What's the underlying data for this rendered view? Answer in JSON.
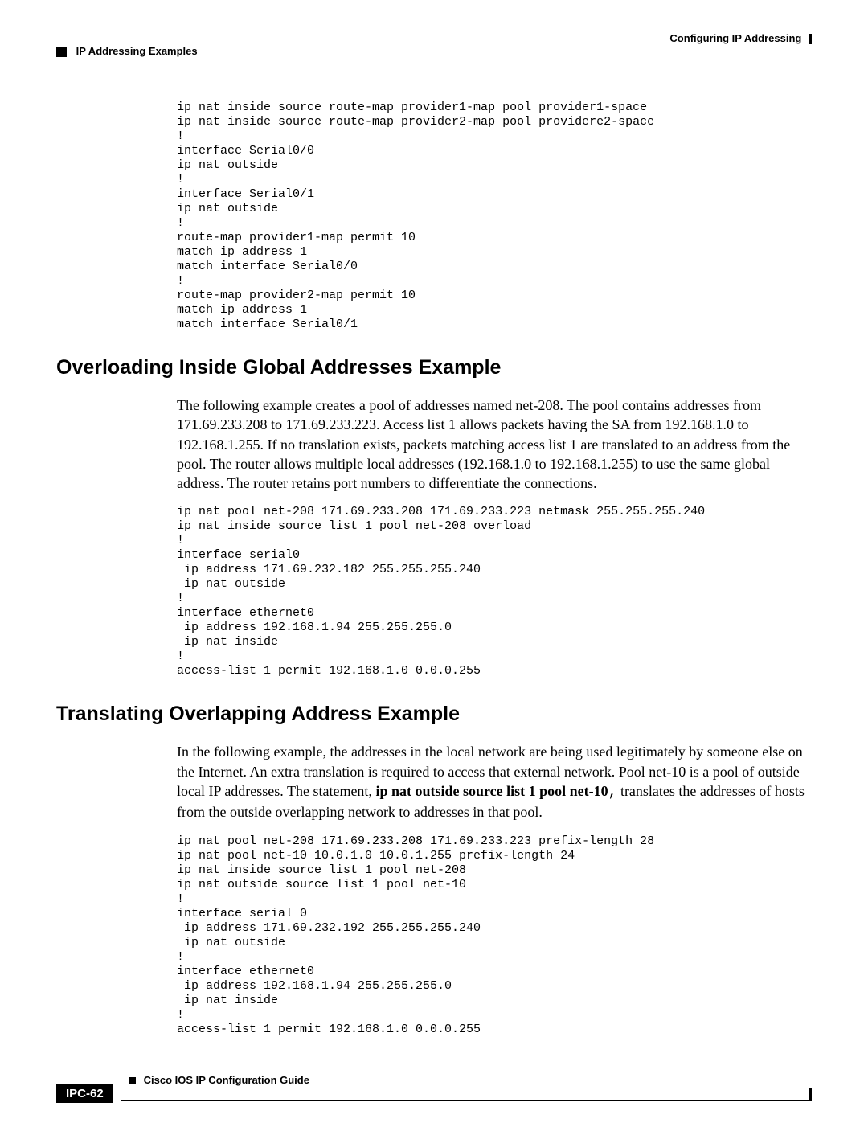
{
  "header": {
    "right_text": "Configuring IP Addressing",
    "left_text": "IP Addressing Examples"
  },
  "code1": "ip nat inside source route-map provider1-map pool provider1-space\nip nat inside source route-map provider2-map pool providere2-space\n!\ninterface Serial0/0\nip nat outside\n!\ninterface Serial0/1\nip nat outside\n!\nroute-map provider1-map permit 10\nmatch ip address 1\nmatch interface Serial0/0\n!\nroute-map provider2-map permit 10\nmatch ip address 1\nmatch interface Serial0/1",
  "section1": {
    "heading": "Overloading Inside Global Addresses Example",
    "paragraph": "The following example creates a pool of addresses named net-208. The pool contains addresses from 171.69.233.208 to 171.69.233.223. Access list 1 allows packets having the SA from 192.168.1.0 to 192.168.1.255. If no translation exists, packets matching access list 1 are translated to an address from the pool. The router allows multiple local addresses (192.168.1.0 to 192.168.1.255) to use the same global address. The router retains port numbers to differentiate the connections.",
    "code": "ip nat pool net-208 171.69.233.208 171.69.233.223 netmask 255.255.255.240\nip nat inside source list 1 pool net-208 overload\n!\ninterface serial0\n ip address 171.69.232.182 255.255.255.240\n ip nat outside\n!\ninterface ethernet0\n ip address 192.168.1.94 255.255.255.0\n ip nat inside\n!\naccess-list 1 permit 192.168.1.0 0.0.0.255"
  },
  "section2": {
    "heading": "Translating Overlapping Address Example",
    "para_part1": "In the following example, the addresses in the local network are being used legitimately by someone else on the Internet. An extra translation is required to access that external network. Pool net-10 is a pool of outside local IP addresses. The statement, ",
    "para_bold": "ip nat outside source list 1 pool net-10",
    "para_mono": ",",
    "para_part2": " translates the addresses of hosts from the outside overlapping network to addresses in that pool.",
    "code": "ip nat pool net-208 171.69.233.208 171.69.233.223 prefix-length 28\nip nat pool net-10 10.0.1.0 10.0.1.255 prefix-length 24\nip nat inside source list 1 pool net-208\nip nat outside source list 1 pool net-10\n!\ninterface serial 0\n ip address 171.69.232.192 255.255.255.240\n ip nat outside\n!\ninterface ethernet0\n ip address 192.168.1.94 255.255.255.0\n ip nat inside\n!\naccess-list 1 permit 192.168.1.0 0.0.0.255"
  },
  "footer": {
    "title": "Cisco IOS IP Configuration Guide",
    "page": "IPC-62"
  }
}
